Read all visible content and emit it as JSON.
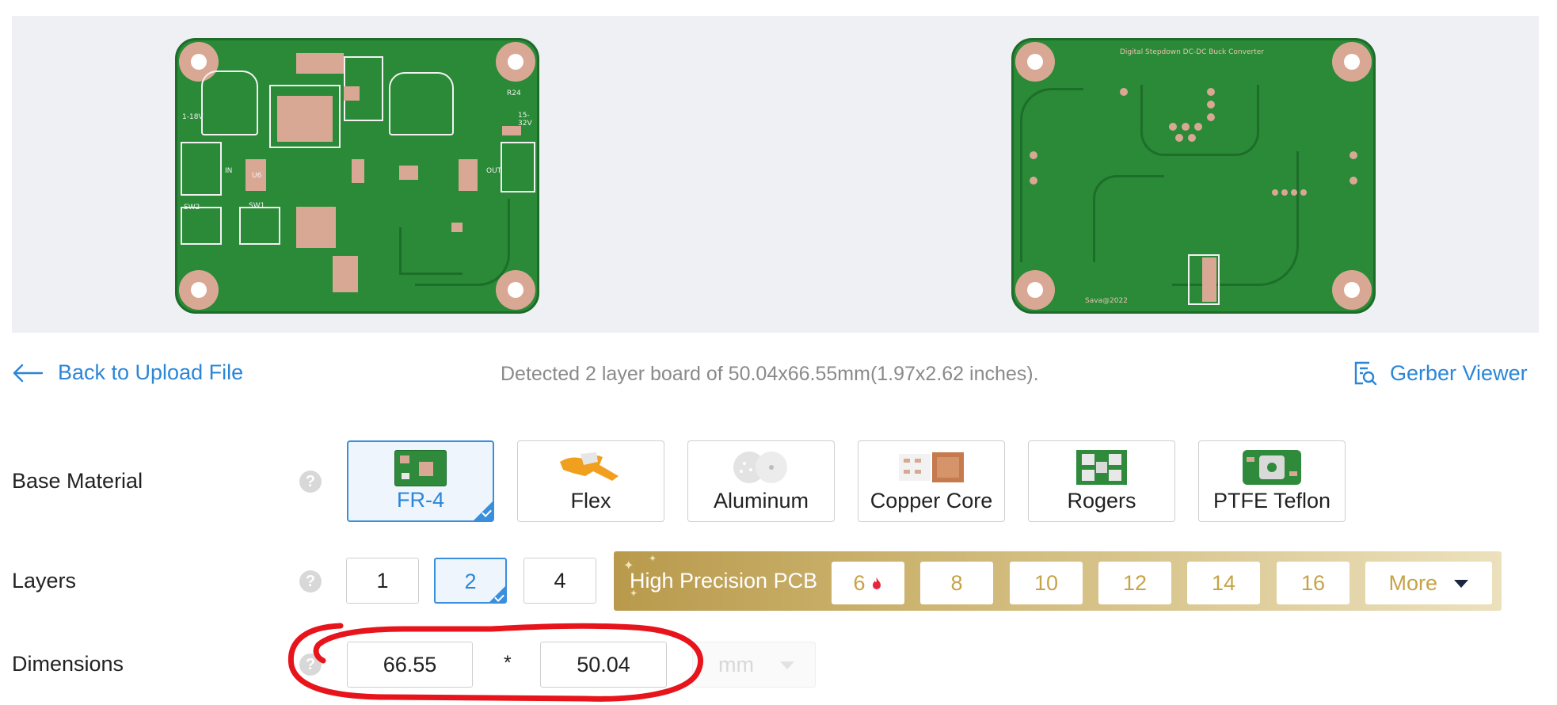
{
  "preview": {
    "top_board_text": [
      "Digital Stepdown DC-DC Buck Converter"
    ],
    "bottom_board_text": "Sava@2022",
    "top_silk_labels": [
      "SW2",
      "SW1",
      "U6",
      "IN",
      "OUT",
      "15-32V",
      "1-18V",
      "R24"
    ]
  },
  "nav": {
    "back_label": "Back to Upload File",
    "detected_text": "Detected 2 layer board of 50.04x66.55mm(1.97x2.62 inches).",
    "gerber_label": "Gerber Viewer"
  },
  "base_material": {
    "label": "Base Material",
    "help": "?",
    "options": [
      {
        "label": "FR-4",
        "selected": true
      },
      {
        "label": "Flex",
        "selected": false
      },
      {
        "label": "Aluminum",
        "selected": false
      },
      {
        "label": "Copper Core",
        "selected": false
      },
      {
        "label": "Rogers",
        "selected": false
      },
      {
        "label": "PTFE Teflon",
        "selected": false
      }
    ]
  },
  "layers": {
    "label": "Layers",
    "help": "?",
    "options": [
      "1",
      "2",
      "4"
    ],
    "selected": "2",
    "high_precision_label": "High Precision PCB",
    "high_precision_options": [
      "6",
      "8",
      "10",
      "12",
      "14",
      "16"
    ],
    "more_label": "More"
  },
  "dimensions": {
    "label": "Dimensions",
    "help": "?",
    "length": "66.55",
    "separator": "*",
    "width": "50.04",
    "unit": "mm"
  },
  "colors": {
    "accent": "#2b86d8",
    "gold": "#c7a347",
    "annotation": "#e8141c",
    "pcb_green": "#2a8a37"
  }
}
